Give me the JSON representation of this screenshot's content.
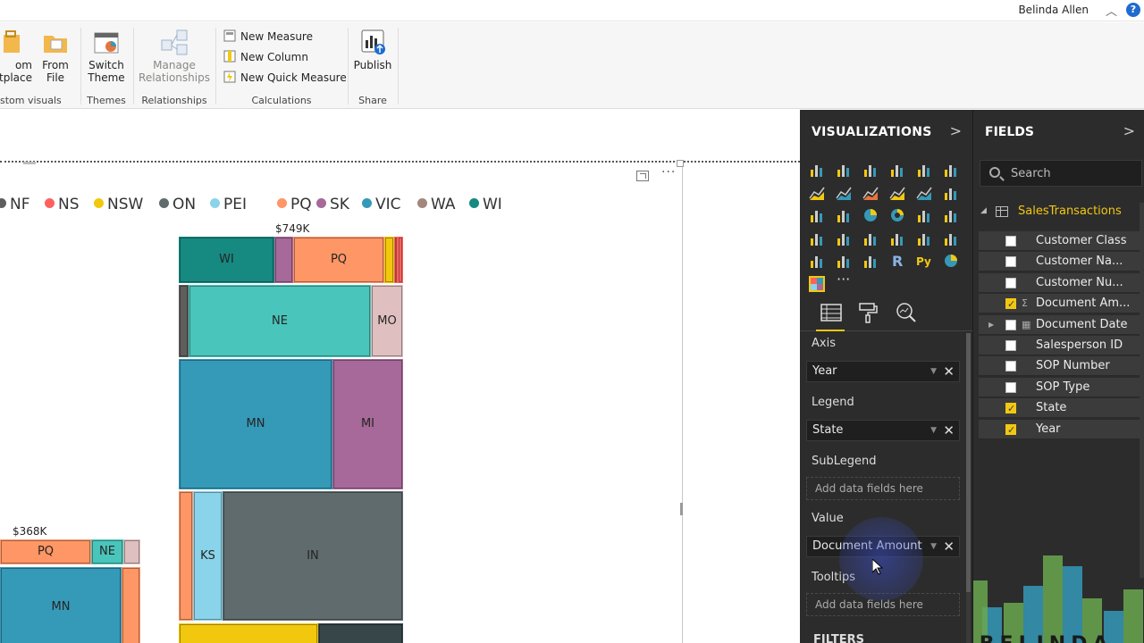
{
  "titlebar": {
    "user_name": "Belinda Allen",
    "help_label": "?"
  },
  "ribbon": {
    "custom_visuals": {
      "marketplace_label": "om\netplace",
      "from_file_label": "From\nFile",
      "group_label": "stom visuals"
    },
    "themes": {
      "switch_theme_label": "Switch\nTheme",
      "group_label": "Themes"
    },
    "relationships": {
      "manage_label": "Manage\nRelationships",
      "group_label": "Relationships"
    },
    "calculations": {
      "new_measure": "New Measure",
      "new_column": "New Column",
      "new_quick_measure": "New Quick Measure",
      "group_label": "Calculations"
    },
    "share": {
      "publish_label": "Publish",
      "group_label": "Share"
    }
  },
  "visual": {
    "more_label": "···",
    "legend": [
      {
        "label": "NF",
        "color": "#605e5c"
      },
      {
        "label": "NS",
        "color": "#fd625e"
      },
      {
        "label": "NSW",
        "color": "#f2c80f"
      },
      {
        "label": "ON",
        "color": "#5f6b6d"
      },
      {
        "label": "PEI",
        "color": "#8ad4eb"
      },
      {
        "label": "PQ",
        "color": "#fe9666"
      },
      {
        "label": "SK",
        "color": "#a66999"
      },
      {
        "label": "VIC",
        "color": "#3599b8"
      },
      {
        "label": "WA",
        "color": "#a3877c"
      },
      {
        "label": "WI",
        "color": "#168980"
      }
    ],
    "totals": {
      "col2": "$749K",
      "col1": "$368K"
    },
    "tiles": {
      "wi": "WI",
      "pq": "PQ",
      "ne": "NE",
      "mo": "MO",
      "mn": "MN",
      "mi": "MI",
      "ks": "KS",
      "in": "IN",
      "pq2": "PQ",
      "ne2": "NE",
      "mn2": "MN"
    },
    "colors": {
      "wi": "#168980",
      "sk": "#a66999",
      "pq": "#fe9666",
      "nsw": "#f2c80f",
      "ns": "#fd625e",
      "nf": "#605e5c",
      "ne": "#4ac5bb",
      "mo": "#dfbfbf",
      "mn": "#3599b8",
      "mi": "#a66999",
      "ks": "#8ad4eb",
      "in": "#5f6b6d",
      "dark": "#374649"
    }
  },
  "visualizations": {
    "title": "VISUALIZATIONS",
    "more_label": "···",
    "wells": {
      "axis_title": "Axis",
      "axis_value": "Year",
      "legend_title": "Legend",
      "legend_value": "State",
      "sublegend_title": "SubLegend",
      "sublegend_placeholder": "Add data fields here",
      "value_title": "Value",
      "value_value": "Document Amount",
      "tooltips_title": "Tooltips",
      "tooltips_placeholder": "Add data fields here"
    },
    "filters_title": "FILTERS"
  },
  "fields": {
    "title": "FIELDS",
    "search_placeholder": "Search",
    "table_name": "SalesTransactions",
    "items": [
      {
        "name": "Customer Class",
        "checked": false
      },
      {
        "name": "Customer Na...",
        "checked": false
      },
      {
        "name": "Customer Nu...",
        "checked": false
      },
      {
        "name": "Document Am...",
        "checked": true
      },
      {
        "name": "Document Date",
        "checked": false
      },
      {
        "name": "Salesperson ID",
        "checked": false
      },
      {
        "name": "SOP Number",
        "checked": false
      },
      {
        "name": "SOP Type",
        "checked": false
      },
      {
        "name": "State",
        "checked": true
      },
      {
        "name": "Year",
        "checked": true
      }
    ],
    "brand_text": "BLBELINDA"
  }
}
